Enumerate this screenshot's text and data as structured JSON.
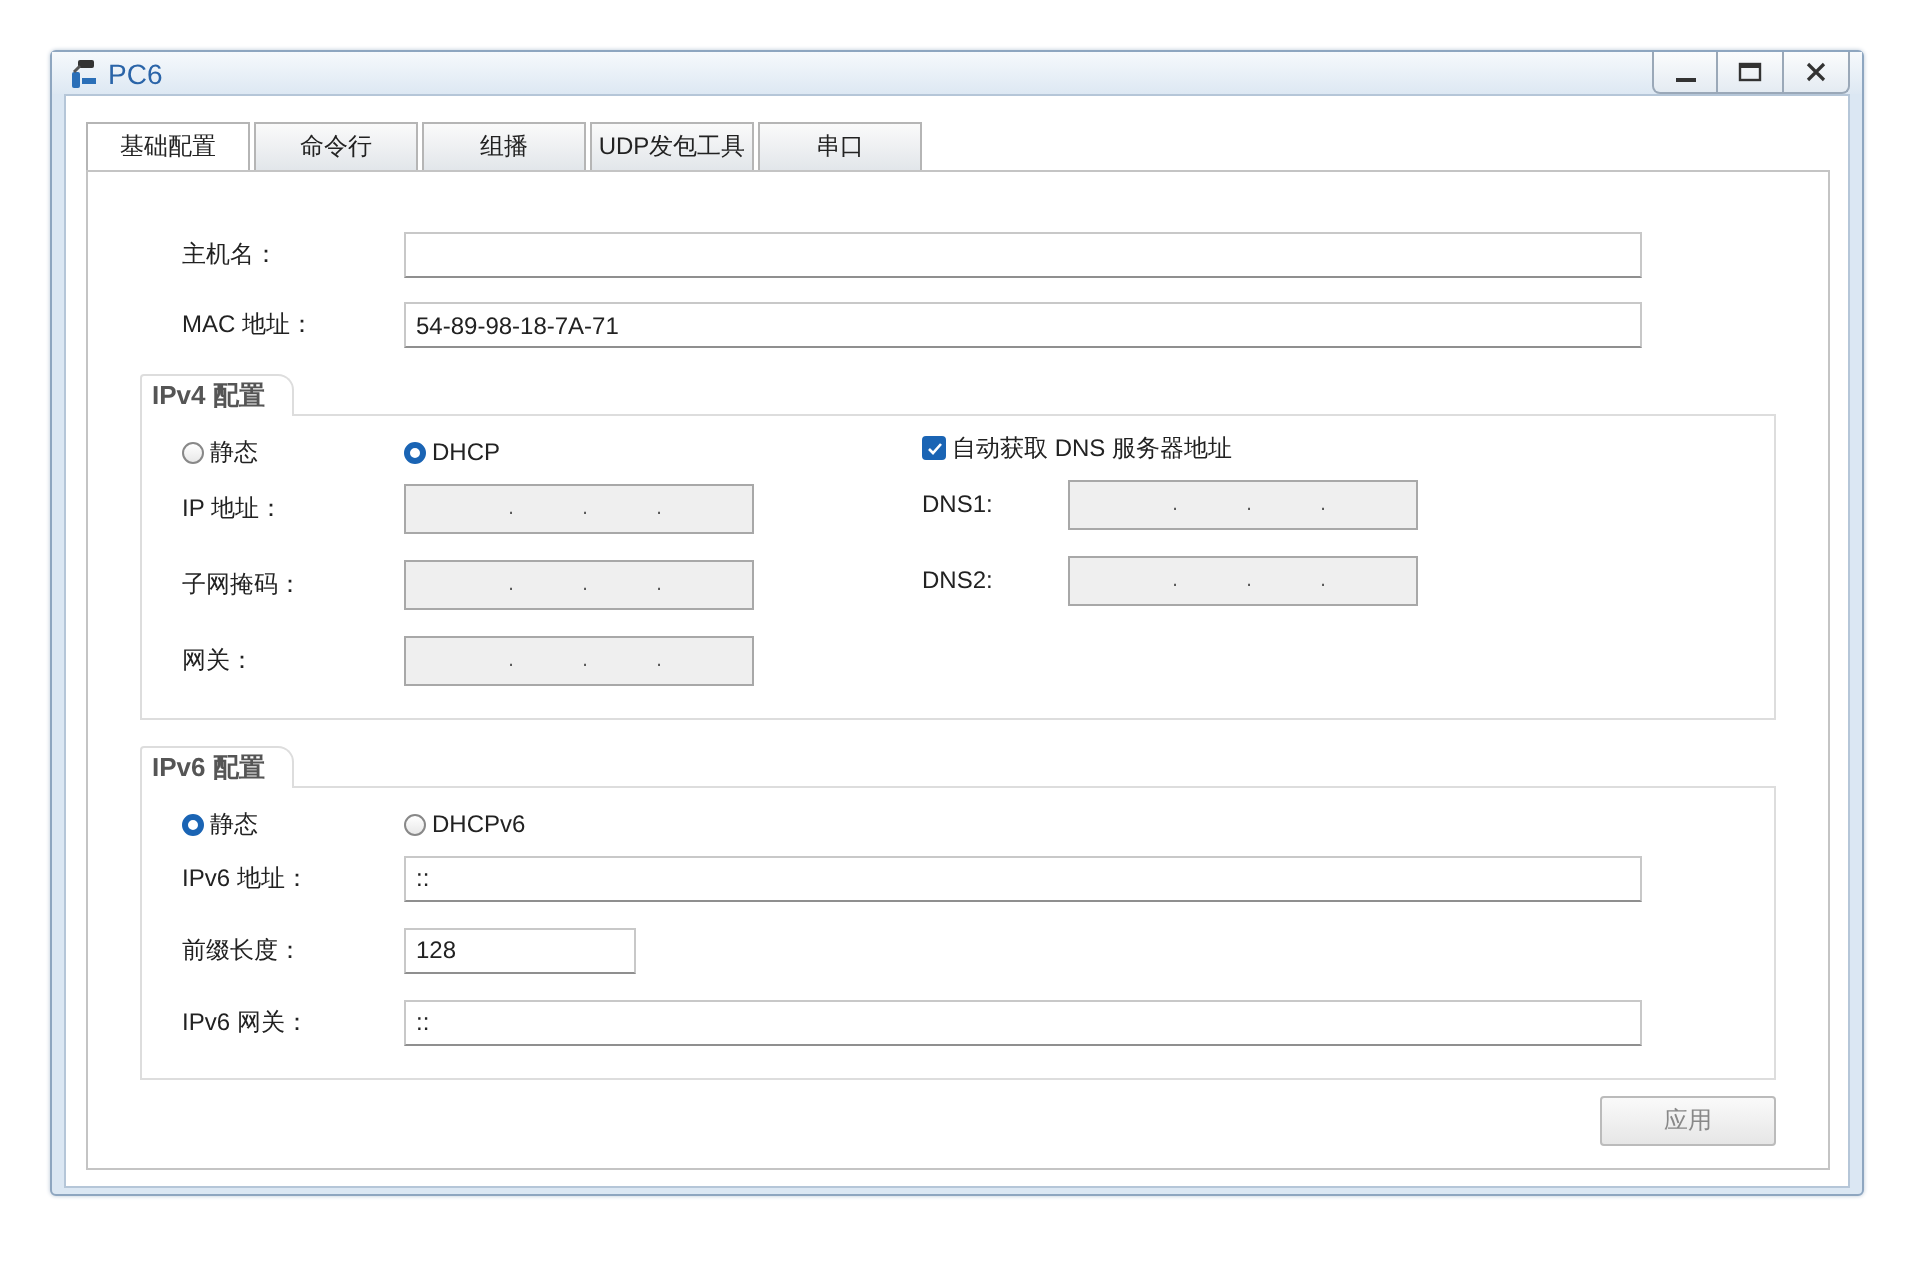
{
  "window": {
    "title": "PC6"
  },
  "tabs": [
    {
      "label": "基础配置",
      "selected": true
    },
    {
      "label": "命令行",
      "selected": false
    },
    {
      "label": "组播",
      "selected": false
    },
    {
      "label": "UDP发包工具",
      "selected": false
    },
    {
      "label": "串口",
      "selected": false
    }
  ],
  "host_fields": [
    {
      "label": "主机名："
    },
    {
      "label": "MAC 地址：",
      "value": "54-89-98-18-7A-71"
    }
  ],
  "ipv4": {
    "title": "IPv4 配置",
    "modes": [
      {
        "label": "静态",
        "selected": false
      },
      {
        "label": "DHCP",
        "selected": true
      }
    ],
    "auto_dns": {
      "label": "自动获取 DNS 服务器地址",
      "checked": true
    },
    "address_fields": [
      {
        "label": "IP 地址：",
        "separators": [
          ".",
          ".",
          "."
        ],
        "disabled": true
      },
      {
        "label": "子网掩码：",
        "separators": [
          ".",
          ".",
          "."
        ],
        "disabled": true
      },
      {
        "label": "网关：",
        "separators": [
          ".",
          ".",
          "."
        ],
        "disabled": true
      }
    ],
    "dns_fields": [
      {
        "label": "DNS1:",
        "separators": [
          ".",
          ".",
          "."
        ],
        "disabled": true
      },
      {
        "label": "DNS2:",
        "separators": [
          ".",
          ".",
          "."
        ],
        "disabled": true
      }
    ]
  },
  "ipv6": {
    "title": "IPv6 配置",
    "modes": [
      {
        "label": "静态",
        "selected": true
      },
      {
        "label": "DHCPv6",
        "selected": false
      }
    ],
    "fields": [
      {
        "label": "IPv6 地址：",
        "value": "::",
        "kind": "wide"
      },
      {
        "label": "前缀长度：",
        "value": "128",
        "kind": "short"
      },
      {
        "label": "IPv6 网关：",
        "value": "::",
        "kind": "wide"
      }
    ]
  },
  "apply_button": {
    "label": "应用",
    "disabled": true
  }
}
